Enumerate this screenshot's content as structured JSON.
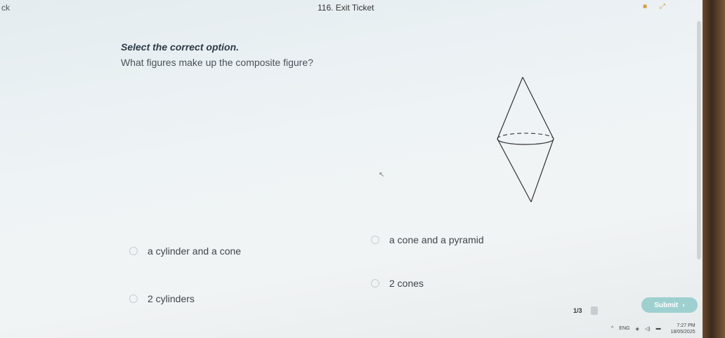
{
  "header": {
    "back_label": "ck",
    "title": "116. Exit Ticket"
  },
  "question": {
    "instruction": "Select the correct option.",
    "prompt": "What figures make up the composite figure?"
  },
  "options": [
    {
      "label": "a cylinder and a cone"
    },
    {
      "label": "a cone and a pyramid"
    },
    {
      "label": "2 cylinders"
    },
    {
      "label": "2 cones"
    }
  ],
  "footer": {
    "page_indicator": "1/3",
    "submit_label": "Submit",
    "submit_arrow": "›"
  },
  "taskbar": {
    "language": "ENG",
    "time": "7:27 PM",
    "date": "18/05/2025"
  },
  "colors": {
    "submit_bg": "#9ed0d0",
    "icon_accent": "#d79b3a"
  }
}
